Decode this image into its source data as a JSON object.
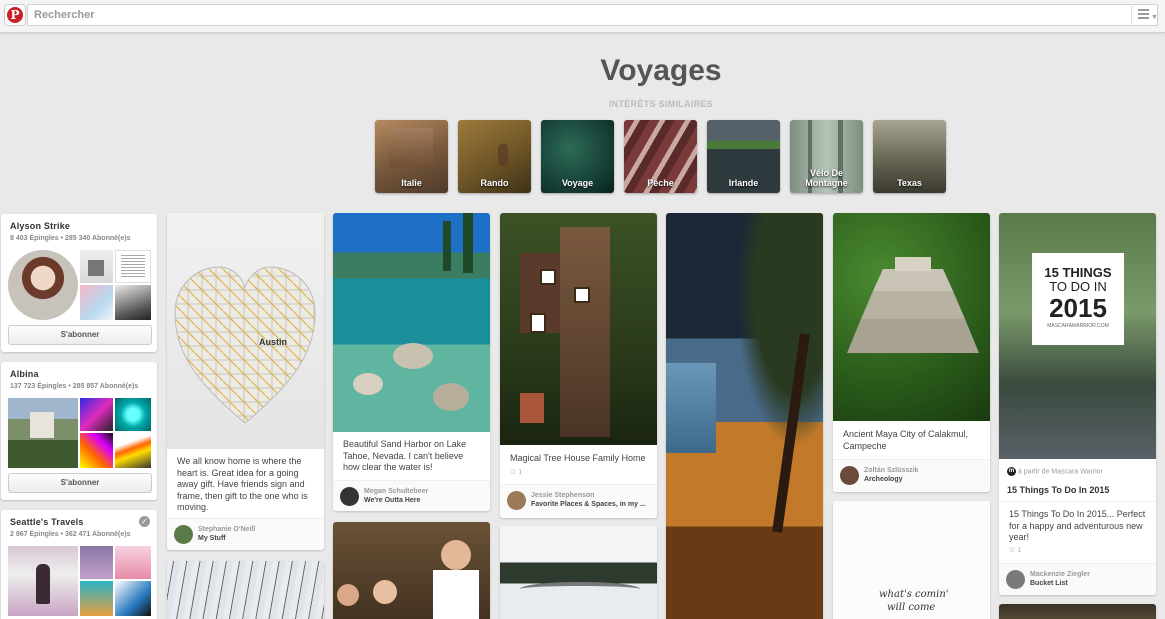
{
  "topbar": {
    "logo": "P",
    "search_placeholder": "Rechercher",
    "menu_icon": "hamburger-icon"
  },
  "header": {
    "title": "Voyages",
    "subtitle": "INTÉRÊTS SIMILAIRES"
  },
  "interests": [
    {
      "label": "Italie"
    },
    {
      "label": "Rando"
    },
    {
      "label": "Voyage"
    },
    {
      "label": "Pêche"
    },
    {
      "label": "Irlande"
    },
    {
      "label": "Vélo De Montagne"
    },
    {
      "label": "Texas"
    }
  ],
  "boards": [
    {
      "name": "Alyson Strike",
      "stats": "8 403 Épingles • 285 340 Abonné(e)s",
      "button": "S'abonner"
    },
    {
      "name": "Albina",
      "stats": "137 723 Épingles • 285 857 Abonné(e)s",
      "button": "S'abonner"
    },
    {
      "name": "Seattle's Travels",
      "stats": "2 967 Épingles • 362 471 Abonné(e)s"
    }
  ],
  "pins": {
    "heart": {
      "map_text": "Austin",
      "desc": "We all know home is where the heart is. Great idea for a going away gift. Have friends sign and frame, then gift to the one who is moving.",
      "user": "Stephanie O'Neill",
      "board": "My Stuff"
    },
    "lake": {
      "desc": "Beautiful Sand Harbor on Lake Tahoe, Nevada. I can't believe how clear the water is!",
      "user": "Megan Schultebeer",
      "board": "We're Outta Here"
    },
    "treehouse": {
      "desc": "Magical Tree House Family Home",
      "repins": "1",
      "user": "Jessie Stephenson",
      "board": "Favorite Places & Spaces, in my ..."
    },
    "maya": {
      "desc": "Ancient Maya City of Calakmul, Campeche",
      "user": "Zoltán Szlüsszik",
      "board": "Archeology"
    },
    "fifteen": {
      "poster_line1": "15 THINGS",
      "poster_line2": "TO DO IN",
      "poster_line3": "2015",
      "poster_site": "MASCARAWARRIOR.COM",
      "source": "à partir de Mascara Warrior",
      "title": "15 Things To Do In 2015",
      "desc": "15 Things To Do In 2015... Perfect for a happy and adventurous new year!",
      "repins": "1",
      "user": "Mackenzie Ziegler",
      "board": "Bucket List"
    },
    "quote": {
      "text_line1": "what's comin'",
      "text_line2": "will come"
    }
  }
}
